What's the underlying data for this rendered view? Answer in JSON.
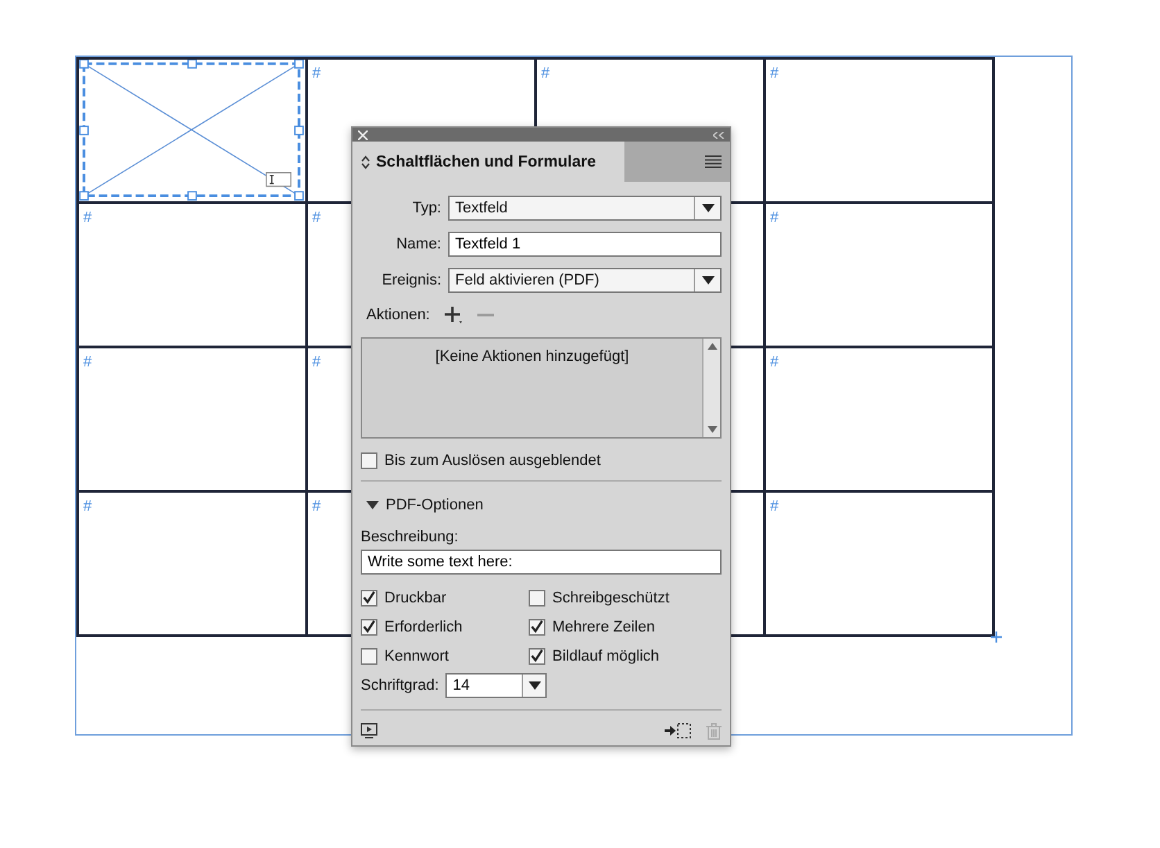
{
  "layout": {
    "cells": [
      {
        "kind": "image_frame",
        "selected": true
      },
      {
        "kind": "text",
        "marker": "#",
        "selected": false
      },
      {
        "kind": "text",
        "marker": "#",
        "selected": false
      },
      {
        "kind": "text",
        "marker": "#",
        "selected": false
      },
      {
        "kind": "text",
        "marker": "#",
        "selected": false
      },
      {
        "kind": "text",
        "marker": "#",
        "selected": false
      },
      {
        "kind": "text",
        "selected": false
      },
      {
        "kind": "text",
        "marker": "#",
        "selected": false
      },
      {
        "kind": "text",
        "marker": "#",
        "selected": false
      },
      {
        "kind": "text",
        "marker": "#",
        "selected": false
      },
      {
        "kind": "text",
        "selected": false
      },
      {
        "kind": "text",
        "marker": "#",
        "selected": false
      },
      {
        "kind": "text",
        "marker": "#",
        "selected": false
      },
      {
        "kind": "text",
        "marker": "#",
        "selected": false
      },
      {
        "kind": "text",
        "selected": false
      },
      {
        "kind": "text",
        "marker": "#",
        "selected": false
      }
    ]
  },
  "panel": {
    "title": "Schaltflächen und Formulare",
    "fields": [
      {
        "kind": "dropdown",
        "label": "Typ:",
        "value": "Textfeld"
      },
      {
        "kind": "input",
        "label": "Name:",
        "value": "Textfeld 1"
      },
      {
        "kind": "dropdown",
        "label": "Ereignis:",
        "value": "Feld aktivieren (PDF)"
      }
    ],
    "actions": {
      "label": "Aktionen:",
      "empty_text": "[Keine Aktionen hinzugefügt]"
    },
    "hidden_until_triggered": {
      "label": "Bis zum Auslösen ausgeblendet",
      "checked": false
    },
    "pdf_options": {
      "label": "PDF-Optionen",
      "expanded": true,
      "description": {
        "label": "Beschreibung:",
        "value": "Write some text here:"
      },
      "options": [
        {
          "label": "Druckbar",
          "checked": true
        },
        {
          "label": "Schreibgeschützt",
          "checked": false
        },
        {
          "label": "Erforderlich",
          "checked": true
        },
        {
          "label": "Mehrere Zeilen",
          "checked": true
        },
        {
          "label": "Kennwort",
          "checked": false
        },
        {
          "label": "Bildlauf möglich",
          "checked": true
        }
      ],
      "font_size": {
        "label": "Schriftgrad:",
        "value": "14"
      }
    },
    "footer": {
      "delete_disabled": true
    }
  }
}
